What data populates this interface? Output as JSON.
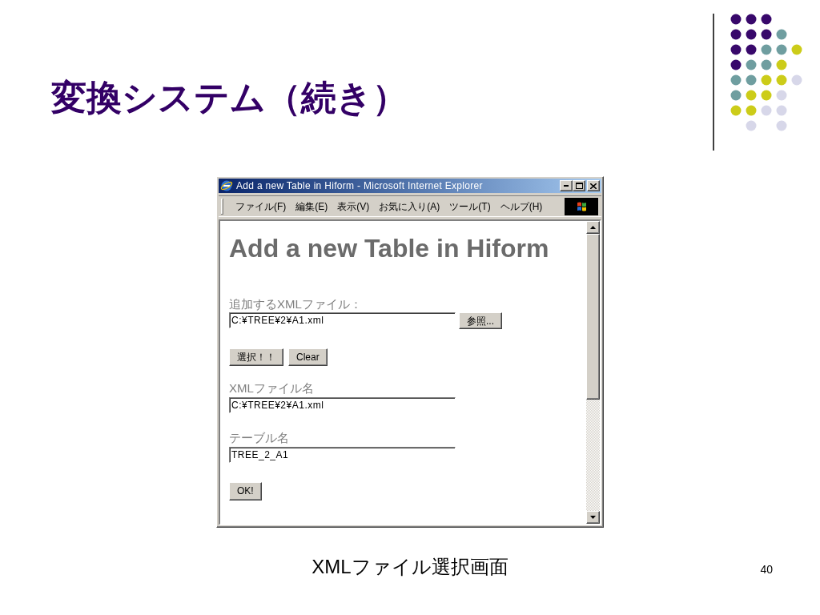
{
  "slide": {
    "title": "変換システム（続き）"
  },
  "browser_window": {
    "title": "Add a new Table in Hiform - Microsoft Internet Explorer",
    "menu": [
      "ファイル(F)",
      "編集(E)",
      "表示(V)",
      "お気に入り(A)",
      "ツール(T)",
      "ヘルプ(H)"
    ],
    "page": {
      "heading": "Add a new Table in Hiform",
      "file_field": {
        "label": "追加するXMLファイル：",
        "value": "C:¥TREE¥2¥A1.xml",
        "browse_button": "参照..."
      },
      "action_buttons": [
        "選択！！",
        "Clear"
      ],
      "fields": [
        {
          "label": "XMLファイル名",
          "value": "C:¥TREE¥2¥A1.xml"
        },
        {
          "label": "テーブル名",
          "value": "TREE_2_A1"
        }
      ],
      "submit_button": "OK!"
    }
  },
  "caption": "XMLファイル選択画面",
  "page_number": "40"
}
